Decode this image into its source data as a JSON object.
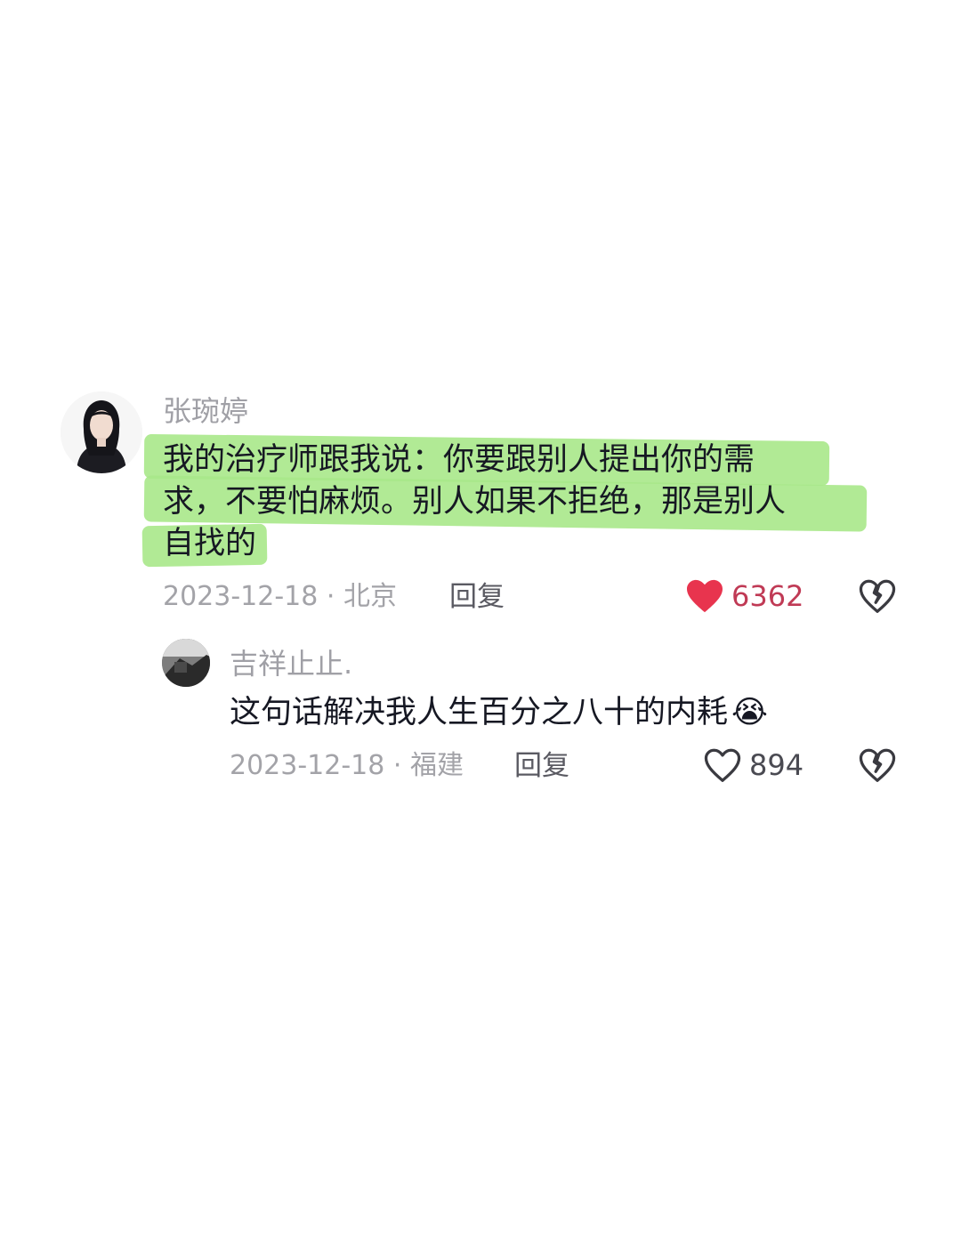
{
  "comment": {
    "username": "张琬婷",
    "text_lines": [
      "我的治疗师跟我说：你要跟别人提出你的需",
      "求，不要怕麻烦。别人如果不拒绝，那是别人",
      "自找的"
    ],
    "date_location": "2023-12-18 · 北京",
    "reply_label": "回复",
    "likes": "6362",
    "liked": true,
    "like_icon": "heart-filled-icon",
    "dislike_icon": "broken-heart-icon",
    "highlight_color": "#a8e88a",
    "like_color": "#e8344e"
  },
  "reply": {
    "username": "吉祥止止.",
    "text": "这句话解决我人生百分之八十的内耗",
    "emoji": "😭",
    "date_location": "2023-12-18 · 福建",
    "reply_label": "回复",
    "likes": "894",
    "liked": false,
    "like_icon": "heart-outline-icon",
    "dislike_icon": "broken-heart-icon"
  }
}
